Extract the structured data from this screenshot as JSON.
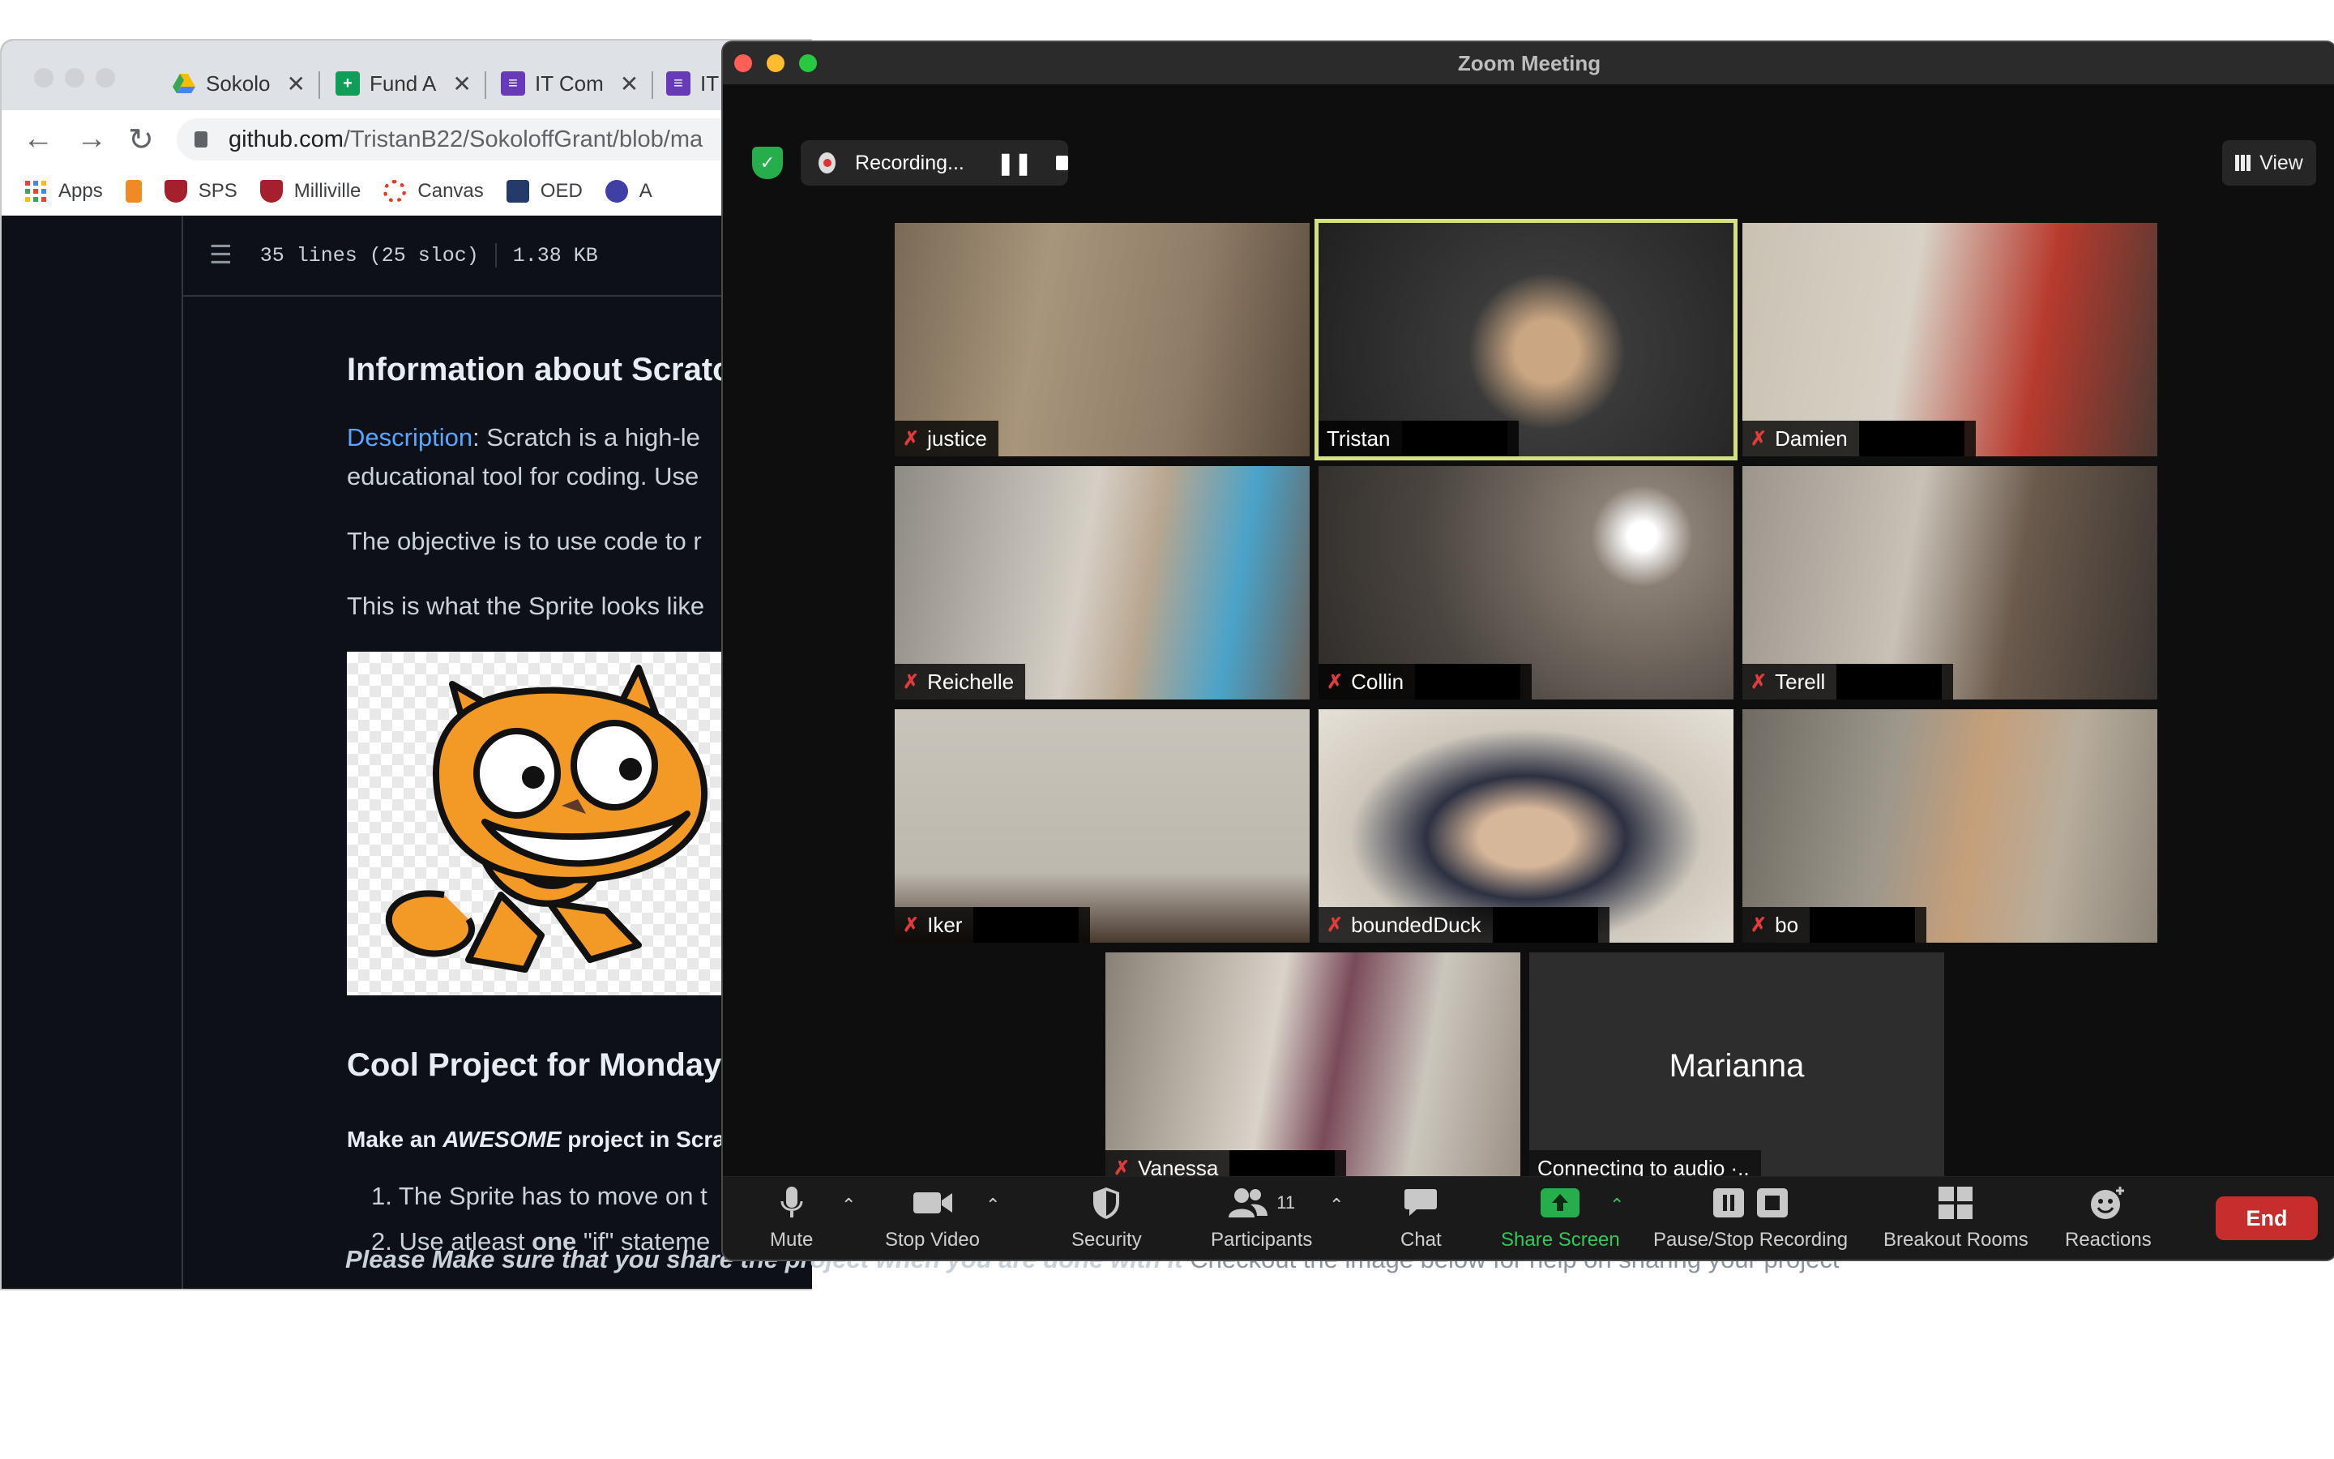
{
  "browser": {
    "tabs": [
      {
        "title": "Sokolo",
        "favicon": "drive-icon"
      },
      {
        "title": "Fund A",
        "favicon": "sheets-icon"
      },
      {
        "title": "IT Com",
        "favicon": "forms-icon"
      },
      {
        "title": "IT",
        "favicon": "forms-icon"
      }
    ],
    "url_host": "github.com",
    "url_path": "/TristanB22/SokoloffGrant/blob/ma",
    "bookmarks": [
      "Apps",
      "",
      "SPS",
      "Milliville",
      "Canvas",
      "OED",
      "A"
    ]
  },
  "github": {
    "file_lines": "35 lines (25 sloc)",
    "file_size": "1.38 KB",
    "heading1": "Information about Scratcl",
    "desc_link": "Description",
    "desc_rest": ": Scratch is a high-le",
    "desc_line2": "educational tool for coding. Use",
    "objective": "The objective is to use code to r",
    "sprite_line": "This is what the Sprite looks like",
    "heading2": "Cool Project for Monday!!",
    "make_pre": "Make an ",
    "make_em": "AWESOME",
    "make_post": " project in Scra",
    "list1": "1. The Sprite has to move on t",
    "list2_pre": "2. Use atleast ",
    "list2_bold": "one",
    "list2_post": " \"if\" stateme",
    "share_bold": "Please Make sure that you share the project when you are done with it",
    "share_rest": " Checkout the image below for help on sharing your project"
  },
  "zoom": {
    "title": "Zoom Meeting",
    "recording": "Recording...",
    "view": "View",
    "participants": [
      {
        "name": "justice",
        "muted": true
      },
      {
        "name": "Tristan",
        "muted": false,
        "active": true
      },
      {
        "name": "Damien",
        "muted": true
      },
      {
        "name": "Reichelle",
        "muted": true
      },
      {
        "name": "Collin",
        "muted": true
      },
      {
        "name": "Terell",
        "muted": true
      },
      {
        "name": "Iker",
        "muted": true
      },
      {
        "name": "boundedDuck",
        "muted": true
      },
      {
        "name": "bo",
        "muted": true
      },
      {
        "name": "Vanessa",
        "muted": true
      }
    ],
    "no_video_name": "Marianna",
    "no_video_status": "Connecting to audio ·..",
    "toolbar": {
      "mute": "Mute",
      "stop_video": "Stop Video",
      "security": "Security",
      "participants": "Participants",
      "participants_count": "11",
      "chat": "Chat",
      "share_screen": "Share Screen",
      "pause_stop": "Pause/Stop Recording",
      "breakout": "Breakout Rooms",
      "reactions": "Reactions",
      "end": "End"
    }
  }
}
